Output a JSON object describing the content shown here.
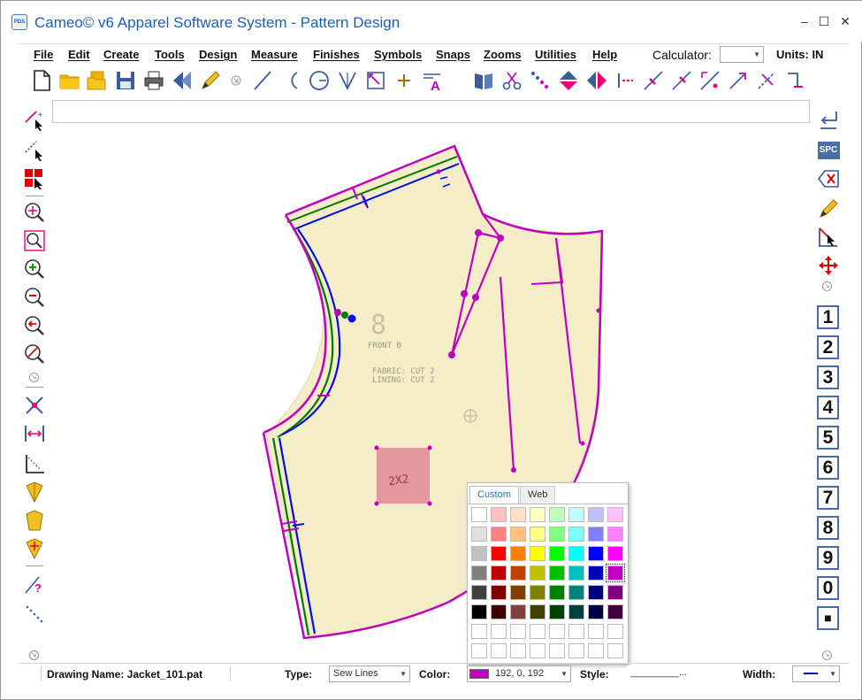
{
  "window": {
    "app_icon_text": "PDS",
    "title": "Cameo© v6 Apparel Software System - Pattern Design",
    "min_glyph": "–",
    "max_glyph": "☐",
    "close_glyph": "✕"
  },
  "menu": {
    "items": [
      "File",
      "Edit",
      "Create",
      "Tools",
      "Design",
      "Measure",
      "Finishes",
      "Symbols",
      "Snaps",
      "Zooms",
      "Utilities",
      "Help"
    ],
    "calculator_label": "Calculator:",
    "calculator_value": "",
    "units_label": "Units: IN"
  },
  "toolbar": {
    "icons": [
      "new-file-icon",
      "open-folder-icon",
      "open-multiple-icon",
      "save-icon",
      "print-icon",
      "back-icon",
      "pencil-icon",
      "line-icon",
      "arc-icon",
      "circle-icon",
      "v-notch-icon",
      "angle-box-icon",
      "point-icon",
      "text-icon",
      "book-icon",
      "cut-icon",
      "dotted-line-icon",
      "flip-vertical-icon",
      "flip-horizontal-icon",
      "split-line-icon",
      "knife-icon",
      "knife-alt-icon",
      "measure-diag-icon",
      "rotate-arrow-icon",
      "slash-icon",
      "corner-icon"
    ]
  },
  "command_input": {
    "value": ""
  },
  "left_toolbar": {
    "icons": [
      "select-points-icon",
      "select-lines-icon",
      "select-pieces-icon",
      "zoom-in-icon",
      "zoom-window-icon",
      "zoom-plus-icon",
      "zoom-minus-icon",
      "zoom-previous-icon",
      "zoom-cancel-icon",
      "move-cross-icon",
      "stretch-icon",
      "dimension-angle-icon",
      "piece-yellow-icon",
      "piece-yellow-alt-icon",
      "piece-yellow-grade-icon",
      "help-query-icon",
      "dotted-diag-icon"
    ]
  },
  "right_toolbar": {
    "spc_label": "SPC",
    "numbers": [
      "1",
      "2",
      "3",
      "4",
      "5",
      "6",
      "7",
      "8",
      "9",
      "0",
      "■"
    ]
  },
  "canvas": {
    "piece_text": [
      "FRONT B",
      "FABRIC: CUT 2",
      "LINING: CUT 2"
    ],
    "size_label": "8",
    "square_label": "2X2"
  },
  "status": {
    "drawing_name_label": "Drawing Name: Jacket_101.pat",
    "type_label": "Type:",
    "type_value": "Sew Lines",
    "color_label": "Color:",
    "color_value": "192, 0, 192",
    "color_hex": "#c000c0",
    "style_label": "Style:",
    "style_value": "_________...",
    "width_label": "Width:"
  },
  "color_popup": {
    "tabs": [
      "Custom",
      "Web"
    ],
    "selected_color": "#c000c0",
    "rows": [
      [
        "#ffffff",
        "#ffc0c0",
        "#ffe0c0",
        "#ffffc0",
        "#c0ffc0",
        "#c0ffff",
        "#c0c0ff",
        "#ffc0ff"
      ],
      [
        "#e0e0e0",
        "#ff8080",
        "#ffc080",
        "#ffff80",
        "#80ff80",
        "#80ffff",
        "#8080ff",
        "#ff80ff"
      ],
      [
        "#c0c0c0",
        "#ff0000",
        "#ff8000",
        "#ffff00",
        "#00ff00",
        "#00ffff",
        "#0000ff",
        "#ff00ff"
      ],
      [
        "#808080",
        "#c00000",
        "#c04000",
        "#c0c000",
        "#00c000",
        "#00c0c0",
        "#0000c0",
        "#c000c0"
      ],
      [
        "#404040",
        "#800000",
        "#804000",
        "#808000",
        "#008000",
        "#008080",
        "#000080",
        "#800080"
      ],
      [
        "#000000",
        "#400000",
        "#804040",
        "#404000",
        "#004000",
        "#004040",
        "#000040",
        "#400040"
      ],
      [
        "#ffffff",
        "#ffffff",
        "#ffffff",
        "#ffffff",
        "#ffffff",
        "#ffffff",
        "#ffffff",
        "#ffffff"
      ],
      [
        "#ffffff",
        "#ffffff",
        "#ffffff",
        "#ffffff",
        "#ffffff",
        "#ffffff",
        "#ffffff",
        "#ffffff"
      ]
    ]
  }
}
